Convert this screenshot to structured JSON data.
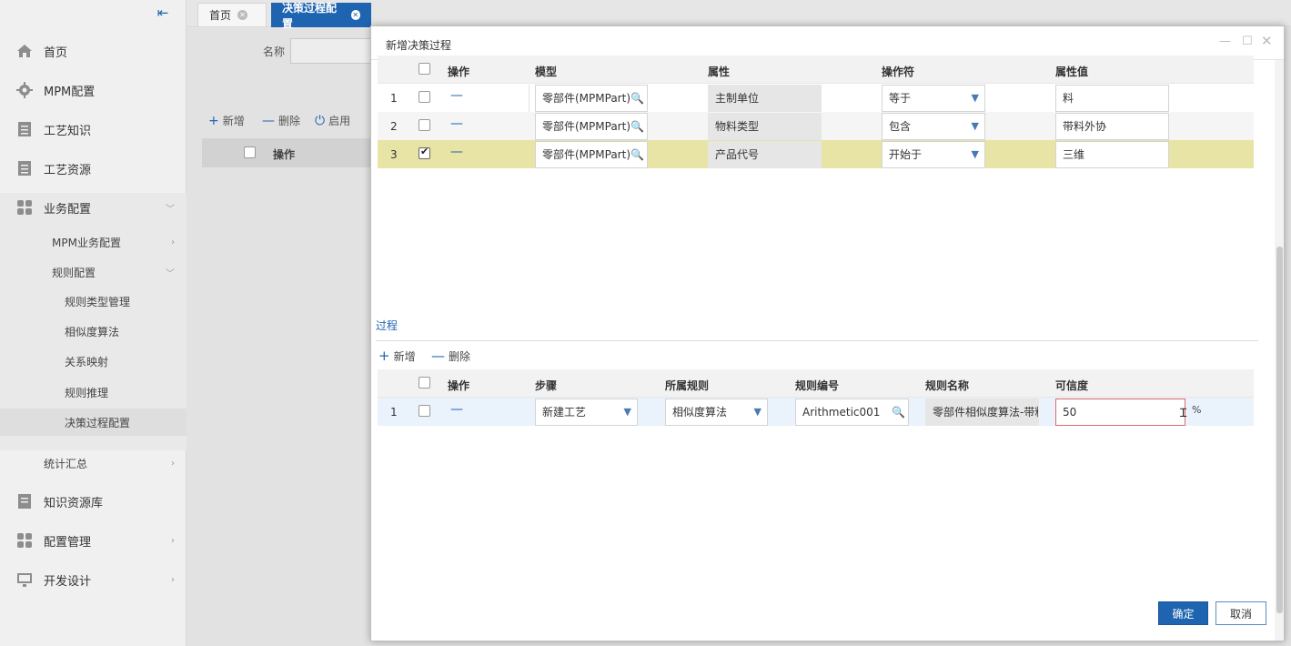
{
  "sidebar": {
    "items": [
      {
        "label": "首页",
        "icon": "home-icon"
      },
      {
        "label": "MPM配置",
        "icon": "gear-icon"
      },
      {
        "label": "工艺知识",
        "icon": "document-icon"
      },
      {
        "label": "工艺资源",
        "icon": "document-icon"
      },
      {
        "label": "业务配置",
        "icon": "modules-icon"
      },
      {
        "label": "MPM业务配置"
      },
      {
        "label": "规则配置"
      },
      {
        "label": "规则类型管理"
      },
      {
        "label": "相似度算法"
      },
      {
        "label": "关系映射"
      },
      {
        "label": "规则推理"
      },
      {
        "label": "决策过程配置"
      },
      {
        "label": "统计汇总"
      },
      {
        "label": "知识资源库",
        "icon": "library-icon"
      },
      {
        "label": "配置管理",
        "icon": "modules-icon"
      },
      {
        "label": "开发设计",
        "icon": "design-icon"
      }
    ]
  },
  "tabs": [
    {
      "label": "首页"
    },
    {
      "label": "决策过程配置"
    }
  ],
  "background": {
    "name_label": "名称",
    "toolbar": [
      "新增",
      "删除",
      "启用"
    ],
    "table_header": "操作"
  },
  "modal": {
    "title": "新增决策过程",
    "conditions": {
      "headers": [
        "操作",
        "模型",
        "属性",
        "操作符",
        "属性值"
      ],
      "rows": [
        {
          "n": "1",
          "checked": false,
          "action": "—",
          "model": "零部件(MPMPart)",
          "attr": "主制单位",
          "op": "等于",
          "value": "料"
        },
        {
          "n": "2",
          "checked": false,
          "action": "—",
          "model": "零部件(MPMPart)",
          "attr": "物料类型",
          "op": "包含",
          "value": "带料外协"
        },
        {
          "n": "3",
          "checked": true,
          "action": "—",
          "model": "零部件(MPMPart)",
          "attr": "产品代号",
          "op": "开始于",
          "value": "三维"
        }
      ]
    },
    "process": {
      "title": "过程",
      "toolbar": {
        "add": "新增",
        "delete": "删除"
      },
      "headers": [
        "操作",
        "步骤",
        "所属规则",
        "规则编号",
        "规则名称",
        "可信度"
      ],
      "rows": [
        {
          "n": "1",
          "checked": false,
          "action": "—",
          "step": "新建工艺",
          "rule": "相似度算法",
          "code": "Arithmetic001",
          "name": "零部件相似度算法-带料",
          "confidence": "50",
          "unit": "%"
        }
      ]
    },
    "buttons": {
      "ok": "确定",
      "cancel": "取消"
    }
  },
  "colors": {
    "primary": "#1f64b0",
    "selected_row": "#e7e4a5",
    "error_border": "#e16a6a"
  }
}
